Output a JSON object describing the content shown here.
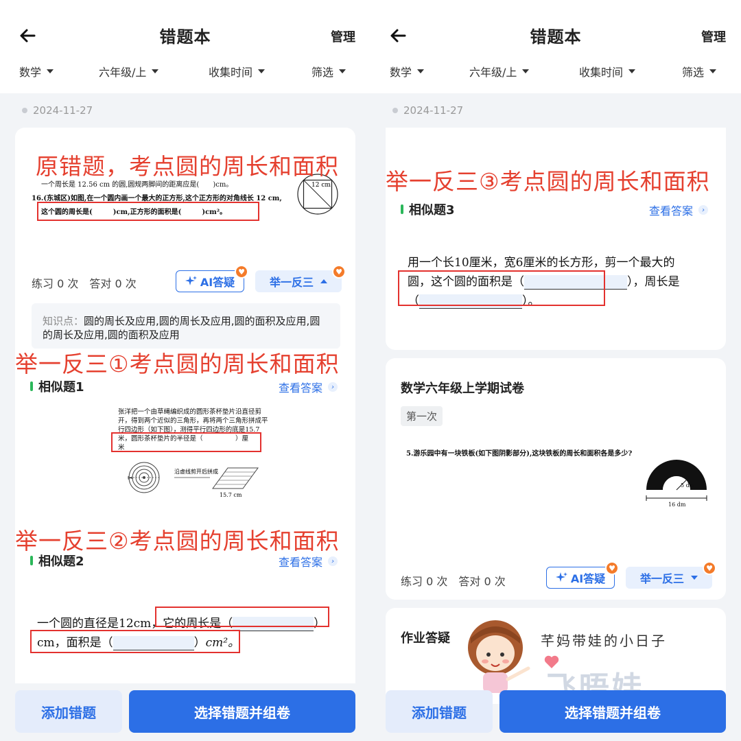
{
  "header": {
    "title": "错题本",
    "manage": "管理"
  },
  "filters": [
    "数学",
    "六年级/上",
    "收集时间",
    "筛选"
  ],
  "date": "2024-11-27",
  "left": {
    "annotation_original": "原错题，考点圆的周长和面积",
    "orig_q_line1": "一个周长是 12.56 cm 的圆,圆规两脚间的距离应是(　　)cm。",
    "orig_q_line2": "16.(东城区)如图,在一个圆内画一个最大的正方形,这个正方形的对角线长 12 cm,",
    "orig_q_line3": "这个圆的周长是(　　　)cm,正方形的面积是(　　　)cm²。",
    "orig_fig_label": "12 cm",
    "stats": "练习 0 次　答对 0 次",
    "ai_label": "AI答疑",
    "jyfs_label": "举一反三",
    "knowledge_label": "知识点：",
    "knowledge_text": "圆的周长及应用,圆的周长及应用,圆的面积及应用,圆的周长及应用,圆的面积及应用",
    "annotation_1": "举一反三①考点圆的周长和面积",
    "sim1_title": "相似题1",
    "view_answer": "查看答案",
    "sim1_lines": [
      "张洋把一个由草绳编织成的圆形茶杯垫片沿直径剪",
      "开，得到两个近似的三角形，再将两个三角形拼成平",
      "行四边形（如下图），测得平行四边形的底是15.7",
      "米，圆形茶杯垫片的半径是（　　　　　）厘",
      "米"
    ],
    "sim1_fig_label1": "沿虚线剪开后拼成",
    "sim1_fig_label2": "15.7 cm",
    "annotation_2": "举一反三②考点圆的周长和面积",
    "sim2_title": "相似题2",
    "sim2_part1": "一个圆的直径是12cm，它的周长是（",
    "sim2_part2": "）",
    "sim2_part3": "cm，面积是（",
    "sim2_part4": "）",
    "sim2_unit": "cm²。",
    "add_btn": "添加错题",
    "compose_btn": "选择错题并组卷"
  },
  "right": {
    "annotation_3": "举一反三③考点圆的周长和面积",
    "sim3_title": "相似题3",
    "view_answer": "查看答案",
    "sim3_line1": "用一个长10厘米，宽6厘米的长方形，剪一个最大的",
    "sim3_line2a": "圆，这个圆的面积是（",
    "sim3_line2b": "），周长是",
    "sim3_line3a": "（",
    "sim3_line3b": "）。",
    "paper_title": "数学六年级上学期试卷",
    "paper_tag": "第一次",
    "paper_q": "5.游乐园中有一块铁板(如下图阴影部分),这块铁板的周长和面积各是多少?",
    "paper_fig_r": "5 dm",
    "paper_fig_w": "16 dm",
    "stats": "练习 0 次　答对 0 次",
    "ai_label": "AI答疑",
    "jyfs_label": "举一反三",
    "hw_title": "作业答疑",
    "watermark_text": "芊妈带娃的小日子",
    "watermark_big": "飞晤娃",
    "add_btn": "添加错题",
    "compose_btn": "选择错题并组卷"
  }
}
